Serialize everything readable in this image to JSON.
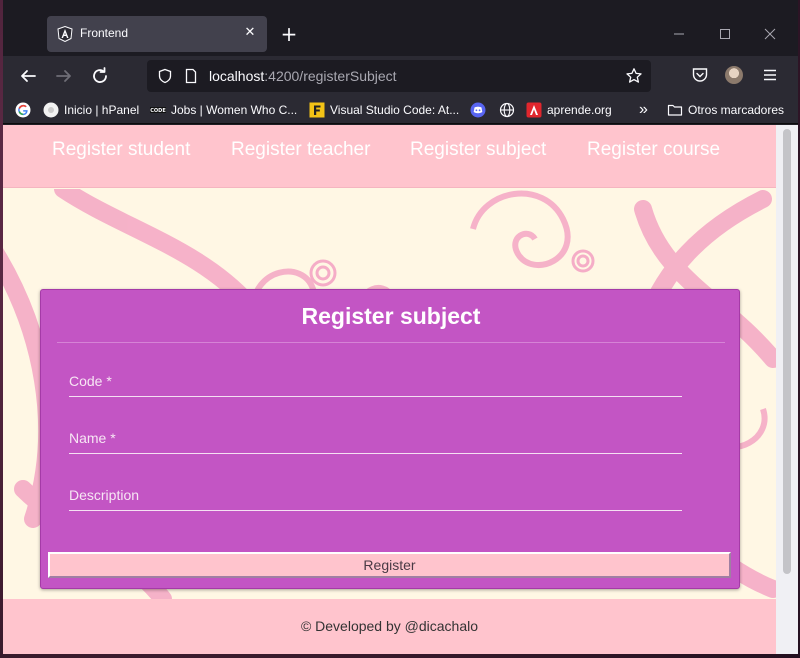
{
  "browser": {
    "tab": {
      "title": "Frontend",
      "close_icon": "close-icon"
    },
    "new_tab_icon": "plus-icon",
    "window_controls": [
      "minimize-icon",
      "maximize-icon",
      "close-icon"
    ],
    "url": {
      "host": "localhost",
      "rest": ":4200/registerSubject"
    },
    "bookmarks": [
      {
        "label": "",
        "icon": "google-icon"
      },
      {
        "label": "Inicio | hPanel",
        "icon": "hpanel-icon"
      },
      {
        "label": "Jobs | Women Who C...",
        "icon": "code-icon"
      },
      {
        "label": "Visual Studio Code: At...",
        "icon": "vscode-f-icon"
      },
      {
        "label": "",
        "icon": "discord-icon"
      },
      {
        "label": "",
        "icon": "globe-icon"
      },
      {
        "label": "aprende.org",
        "icon": "aprende-icon"
      }
    ],
    "bookmarks_overflow": "»",
    "other_bookmarks": "Otros marcadores",
    "colors": {
      "chrome_dark": "#1c1b22",
      "chrome_toolbar": "#2b2a33",
      "tab_active": "#42414d"
    }
  },
  "app": {
    "nav": [
      "Register student",
      "Register teacher",
      "Register subject",
      "Register course"
    ],
    "form": {
      "title": "Register subject",
      "fields": [
        "Code *",
        "Name *",
        "Description"
      ],
      "submit_label": "Register"
    },
    "footer": "© Developed by @dicachalo",
    "colors": {
      "pink": "#ffc4cd",
      "purple_card": "#c355c4",
      "cream_bg": "#fff7e4",
      "swirl": "#f4a6c4"
    }
  }
}
